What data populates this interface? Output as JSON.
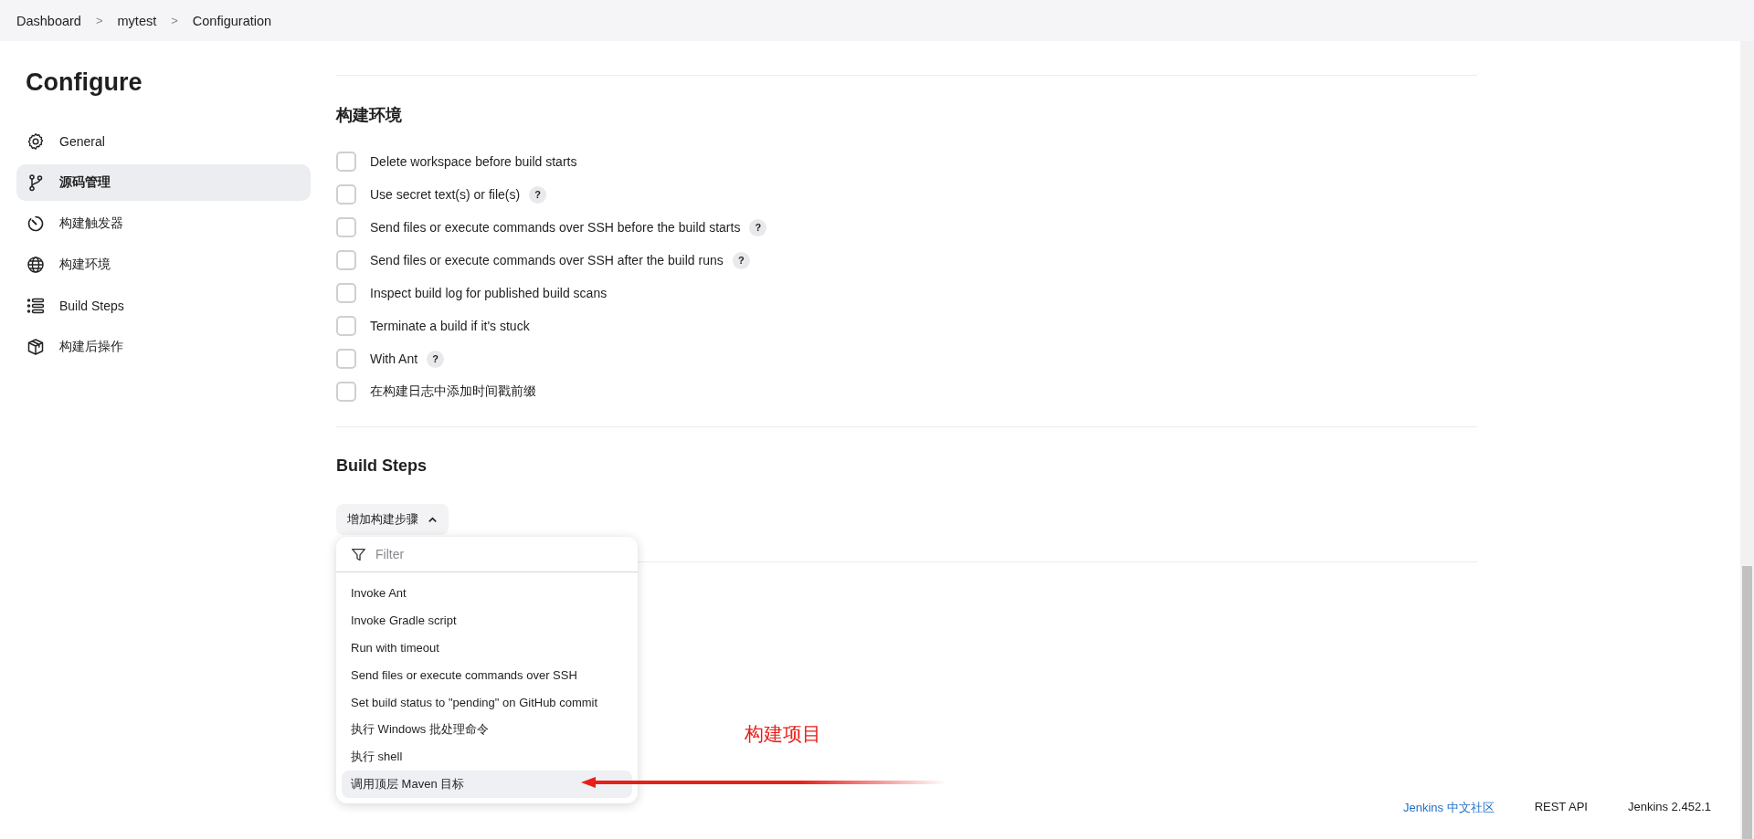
{
  "breadcrumbs": [
    {
      "label": "Dashboard",
      "separator": ">"
    },
    {
      "label": "mytest",
      "separator": ">"
    },
    {
      "label": "Configuration"
    }
  ],
  "sidebar": {
    "title": "Configure",
    "items": [
      {
        "label": "General",
        "selected": false
      },
      {
        "label": "源码管理",
        "selected": true
      },
      {
        "label": "构建触发器",
        "selected": false
      },
      {
        "label": "构建环境",
        "selected": false
      },
      {
        "label": "Build Steps",
        "selected": false
      },
      {
        "label": "构建后操作",
        "selected": false
      }
    ]
  },
  "build_environment": {
    "heading": "构建环境",
    "options": [
      {
        "label": "Delete workspace before build starts",
        "checked": false
      },
      {
        "label": "Use secret text(s) or file(s)",
        "checked": false,
        "help": "?"
      },
      {
        "label": "Send files or execute commands over SSH before the build starts",
        "checked": false,
        "help": "?"
      },
      {
        "label": "Send files or execute commands over SSH after the build runs",
        "checked": false,
        "help": "?"
      },
      {
        "label": "Inspect build log for published build scans",
        "checked": false
      },
      {
        "label": "Terminate a build if it's stuck",
        "checked": false
      },
      {
        "label": "With Ant",
        "checked": false,
        "help": "?"
      },
      {
        "label": "在构建日志中添加时间戳前缀",
        "checked": false
      }
    ]
  },
  "build_steps": {
    "heading": "Build Steps",
    "add_button": {
      "label": "增加构建步骤",
      "expanded": true
    },
    "menu": {
      "filter_placeholder": "Filter",
      "items": [
        {
          "label": "Invoke Ant",
          "selected": false
        },
        {
          "label": "Invoke Gradle script",
          "selected": false
        },
        {
          "label": "Run with timeout",
          "selected": false
        },
        {
          "label": "Send files or execute commands over SSH",
          "selected": false
        },
        {
          "label": "Set build status to \"pending\" on GitHub commit",
          "selected": false
        },
        {
          "label": "执行 Windows 批处理命令",
          "selected": false
        },
        {
          "label": "执行 shell",
          "selected": false
        },
        {
          "label": "调用顶层 Maven 目标",
          "selected": true
        }
      ]
    }
  },
  "annotation": {
    "text": "构建项目"
  },
  "footer": {
    "links": [
      {
        "label": "Jenkins 中文社区",
        "kind": "link"
      },
      {
        "label": "REST API",
        "kind": "plain"
      },
      {
        "label": "Jenkins 2.452.1",
        "kind": "plain"
      }
    ]
  }
}
